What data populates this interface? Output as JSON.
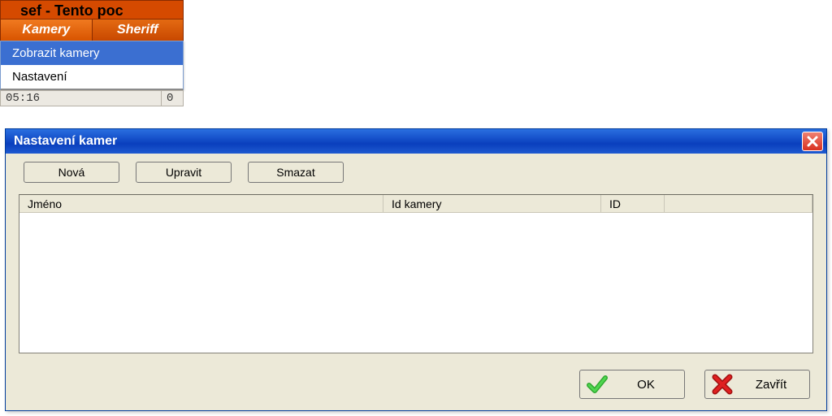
{
  "app": {
    "title_fragment": "sef  -  Tento poc"
  },
  "menubar": {
    "items": [
      "Kamery",
      "Sheriff"
    ]
  },
  "dropdown": {
    "items": [
      "Zobrazit kamery",
      "Nastavení"
    ]
  },
  "statusbar": {
    "time": "05:16",
    "count": "0"
  },
  "dialog": {
    "title": "Nastavení kamer",
    "buttons": {
      "new": "Nová",
      "edit": "Upravit",
      "delete": "Smazat"
    },
    "columns": {
      "name": "Jméno",
      "idcam": "Id kamery",
      "id": "ID"
    },
    "footer": {
      "ok": "OK",
      "close": "Zavřít"
    }
  },
  "colors": {
    "titlebar_blue": "#1a54cc",
    "menubar_orange": "#d85400",
    "dialog_bg": "#ece9d8"
  }
}
